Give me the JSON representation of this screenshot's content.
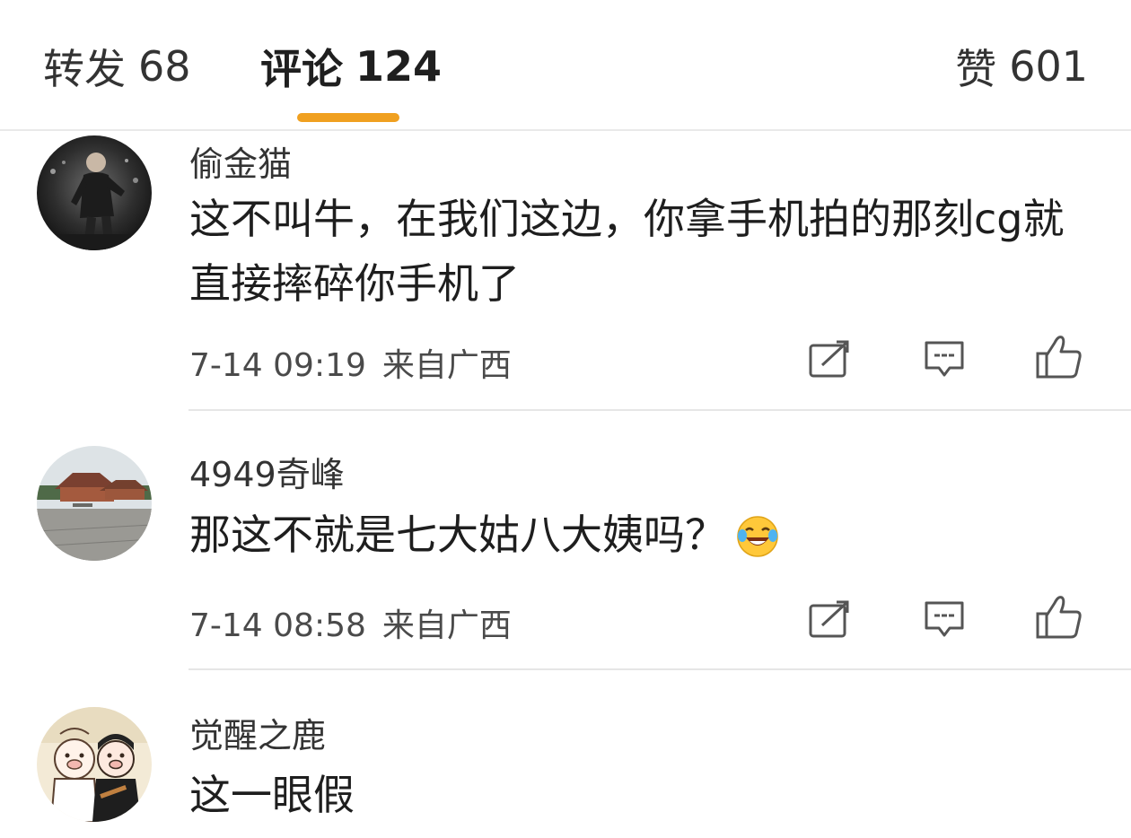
{
  "tabs": {
    "reposts": {
      "label": "转发",
      "count": "68"
    },
    "comments": {
      "label": "评论",
      "count": "124"
    },
    "likes": {
      "label": "赞",
      "count": "601"
    }
  },
  "accent_color": "#f0a020",
  "comments": [
    {
      "username": "偷金猫",
      "content": "这不叫牛，在我们这边，你拿手机拍的那刻cg就直接摔碎你手机了",
      "time": "7-14 09:19",
      "source": "来自广西",
      "avatar": "football-player-avatar"
    },
    {
      "username": "4949奇峰",
      "content": "那这不就是七大姑八大姨吗？",
      "emoji": "laugh-cry-emoji",
      "time": "7-14 08:58",
      "source": "来自广西",
      "avatar": "temple-plaza-avatar"
    },
    {
      "username": "觉醒之鹿",
      "content": "这一眼假",
      "avatar": "cartoon-pigs-avatar"
    }
  ],
  "icons": [
    "repost-icon",
    "comment-icon",
    "like-icon"
  ]
}
